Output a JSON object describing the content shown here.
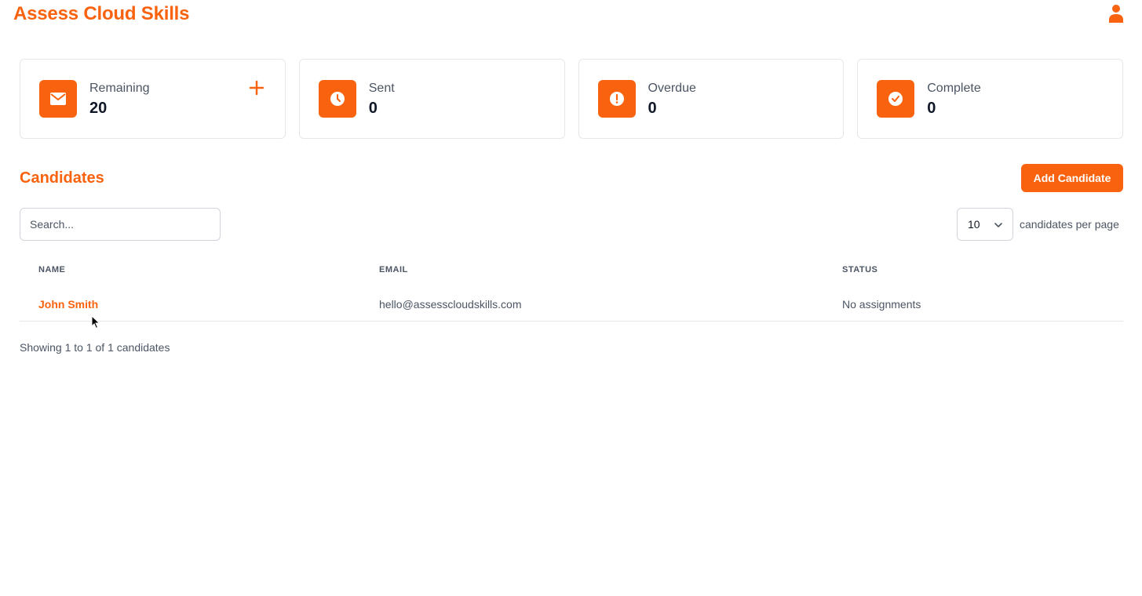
{
  "app": {
    "title": "Assess Cloud Skills"
  },
  "colors": {
    "accent": "#f9630f",
    "text_muted": "#4b5563",
    "border": "#e5e7eb"
  },
  "stats": [
    {
      "label": "Remaining",
      "value": "20",
      "icon": "envelope-icon",
      "has_add": true
    },
    {
      "label": "Sent",
      "value": "0",
      "icon": "clock-icon",
      "has_add": false
    },
    {
      "label": "Overdue",
      "value": "0",
      "icon": "exclamation-icon",
      "has_add": false
    },
    {
      "label": "Complete",
      "value": "0",
      "icon": "check-circle-icon",
      "has_add": false
    }
  ],
  "candidates": {
    "title": "Candidates",
    "add_button": "Add Candidate",
    "search_placeholder": "Search...",
    "per_page_value": "10",
    "per_page_label": "candidates per page",
    "columns": [
      "NAME",
      "EMAIL",
      "STATUS"
    ],
    "rows": [
      {
        "name": "John Smith",
        "email": "hello@assesscloudskills.com",
        "status": "No assignments"
      }
    ],
    "showing": "Showing 1 to 1 of 1 candidates"
  }
}
